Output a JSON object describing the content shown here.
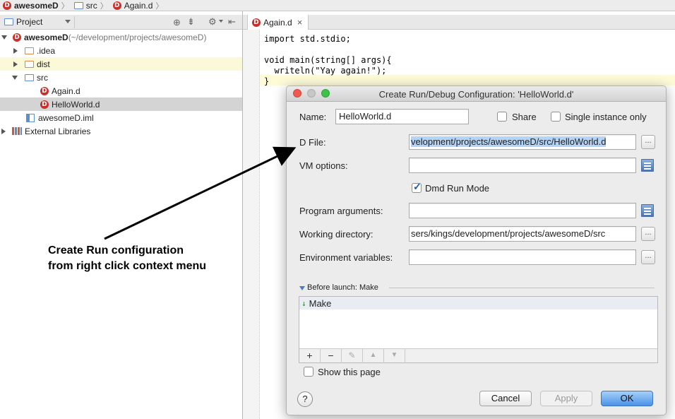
{
  "breadcrumb": {
    "project": "awesomeD",
    "folder": "src",
    "file": "Again.d"
  },
  "project_panel": {
    "title": "Project",
    "tree": [
      {
        "label": "awesomeD",
        "extra": " (~/development/projects/awesomeD)",
        "kind": "project"
      },
      {
        "label": ".idea",
        "kind": "folder"
      },
      {
        "label": "dist",
        "kind": "folder"
      },
      {
        "label": "src",
        "kind": "folder"
      },
      {
        "label": "Again.d",
        "kind": "dfile"
      },
      {
        "label": "HelloWorld.d",
        "kind": "dfile"
      },
      {
        "label": "awesomeD.iml",
        "kind": "iml"
      },
      {
        "label": "External Libraries",
        "kind": "library"
      }
    ]
  },
  "editor": {
    "tab_label": "Again.d",
    "tab_close": "×",
    "lines": [
      "import std.stdio;",
      "",
      "void main(string[] args){",
      "  writeln(\"Yay again!\");",
      "}"
    ]
  },
  "dialog": {
    "title": "Create Run/Debug Configuration: 'HelloWorld.d'",
    "name_label": "Name:",
    "name_value": "HelloWorld.d",
    "share_label": "Share",
    "single_instance_label": "Single instance only",
    "dfile_label": "D File:",
    "dfile_value": "velopment/projects/awesomeD/src/HelloWorld.d",
    "vm_options_label": "VM options:",
    "vm_options_value": "",
    "dmd_run_mode_label": "Dmd Run Mode",
    "dmd_run_mode_checked": true,
    "program_args_label": "Program arguments:",
    "program_args_value": "",
    "working_dir_label": "Working directory:",
    "working_dir_value": "sers/kings/development/projects/awesomeD/src",
    "env_vars_label": "Environment variables:",
    "env_vars_value": "",
    "browse_label": "...",
    "before_launch_label": "Before launch: Make",
    "before_launch_items": [
      "Make"
    ],
    "toolbar": {
      "add": "+",
      "remove": "−",
      "edit": "✎",
      "up": "▲",
      "down": "▼"
    },
    "show_page_label": "Show this page",
    "help_label": "?",
    "cancel_label": "Cancel",
    "apply_label": "Apply",
    "ok_label": "OK"
  },
  "annotation": {
    "text": "Create Run configuration\nfrom right click context menu"
  }
}
